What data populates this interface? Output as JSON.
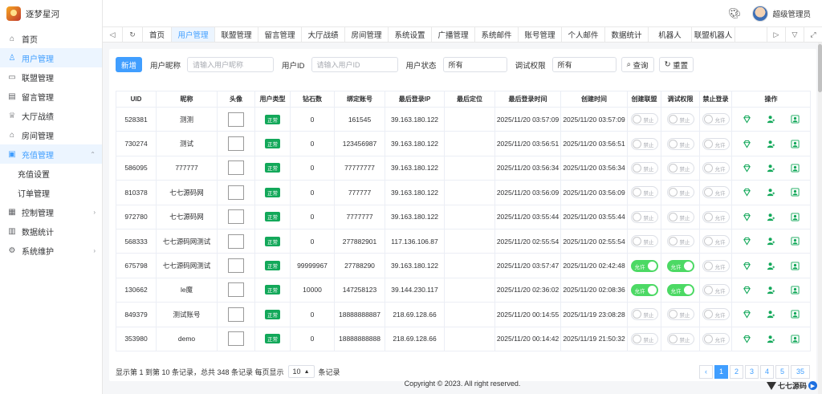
{
  "brand": {
    "name": "逐梦星河"
  },
  "sidebar": {
    "items": [
      {
        "label": "首页",
        "icon": "home-icon",
        "glyph": "⌂"
      },
      {
        "label": "用户管理",
        "icon": "user-icon",
        "glyph": "👤"
      },
      {
        "label": "联盟管理",
        "icon": "alliance-icon",
        "glyph": "▭"
      },
      {
        "label": "留言管理",
        "icon": "message-icon",
        "glyph": "✉"
      },
      {
        "label": "大厅战绩",
        "icon": "trophy-icon",
        "glyph": "♕"
      },
      {
        "label": "房间管理",
        "icon": "room-icon",
        "glyph": "⌂"
      },
      {
        "label": "充值管理",
        "icon": "recharge-icon",
        "glyph": "▣"
      },
      {
        "label": "充值设置"
      },
      {
        "label": "订单管理"
      },
      {
        "label": "控制管理",
        "icon": "control-icon",
        "glyph": "▦"
      },
      {
        "label": "数据统计",
        "icon": "stats-icon",
        "glyph": "▥"
      },
      {
        "label": "系统维护",
        "icon": "settings-icon",
        "glyph": "⚙"
      }
    ]
  },
  "topbar": {
    "username": "超级管理员"
  },
  "tabs": [
    "首页",
    "用户管理",
    "联盟管理",
    "留言管理",
    "大厅战绩",
    "房间管理",
    "系统设置",
    "广播管理",
    "系统邮件",
    "账号管理",
    "个人邮件",
    "数据统计",
    "机器人",
    "联盟机器人"
  ],
  "filter": {
    "add_label": "新增",
    "nickname_label": "用户昵称",
    "nickname_placeholder": "请输入用户昵称",
    "uid_label": "用户ID",
    "uid_placeholder": "请输入用户ID",
    "status_label": "用户状态",
    "status_value": "所有",
    "debug_label": "调试权限",
    "debug_value": "所有",
    "search_label": "查询",
    "reset_label": "重置"
  },
  "table": {
    "headers": [
      "UID",
      "昵称",
      "头像",
      "用户类型",
      "钻石数",
      "绑定账号",
      "最后登录IP",
      "最后定位",
      "最后登录时间",
      "创建时间",
      "创建联盟",
      "调试权限",
      "禁止登录",
      "操作"
    ],
    "rows": [
      {
        "uid": "528381",
        "nick": "测测",
        "type": "正常",
        "diamond": "0",
        "account": "161545",
        "ip": "39.163.180.122",
        "loc": "",
        "last": "2025/11/20 03:57:09",
        "created": "2025/11/20 03:57:09",
        "alliance": false,
        "debug": false,
        "ban": false
      },
      {
        "uid": "730274",
        "nick": "测试",
        "type": "正常",
        "diamond": "0",
        "account": "123456987",
        "ip": "39.163.180.122",
        "loc": "",
        "last": "2025/11/20 03:56:51",
        "created": "2025/11/20 03:56:51",
        "alliance": false,
        "debug": false,
        "ban": false
      },
      {
        "uid": "586095",
        "nick": "777777",
        "type": "正常",
        "diamond": "0",
        "account": "77777777",
        "ip": "39.163.180.122",
        "loc": "",
        "last": "2025/11/20 03:56:34",
        "created": "2025/11/20 03:56:34",
        "alliance": false,
        "debug": false,
        "ban": false
      },
      {
        "uid": "810378",
        "nick": "七七源码网",
        "type": "正常",
        "diamond": "0",
        "account": "777777",
        "ip": "39.163.180.122",
        "loc": "",
        "last": "2025/11/20 03:56:09",
        "created": "2025/11/20 03:56:09",
        "alliance": false,
        "debug": false,
        "ban": false
      },
      {
        "uid": "972780",
        "nick": "七七源码网",
        "type": "正常",
        "diamond": "0",
        "account": "7777777",
        "ip": "39.163.180.122",
        "loc": "",
        "last": "2025/11/20 03:55:44",
        "created": "2025/11/20 03:55:44",
        "alliance": false,
        "debug": false,
        "ban": false
      },
      {
        "uid": "568333",
        "nick": "七七源码网测试",
        "type": "正常",
        "diamond": "0",
        "account": "277882901",
        "ip": "117.136.106.87",
        "loc": "",
        "last": "2025/11/20 02:55:54",
        "created": "2025/11/20 02:55:54",
        "alliance": false,
        "debug": false,
        "ban": false
      },
      {
        "uid": "675798",
        "nick": "七七源码网测试",
        "type": "正常",
        "diamond": "99999967",
        "account": "27788290",
        "ip": "39.163.180.122",
        "loc": "",
        "last": "2025/11/20 03:57:47",
        "created": "2025/11/20 02:42:48",
        "alliance": true,
        "debug": true,
        "ban": false
      },
      {
        "uid": "130662",
        "nick": "le魔",
        "type": "正常",
        "diamond": "10000",
        "account": "147258123",
        "ip": "39.144.230.117",
        "loc": "",
        "last": "2025/11/20 02:36:02",
        "created": "2025/11/20 02:08:36",
        "alliance": true,
        "debug": true,
        "ban": false
      },
      {
        "uid": "849379",
        "nick": "测试账号",
        "type": "正常",
        "diamond": "0",
        "account": "18888888887",
        "ip": "218.69.128.66",
        "loc": "",
        "last": "2025/11/20 00:14:55",
        "created": "2025/11/19 23:08:28",
        "alliance": false,
        "debug": false,
        "ban": false
      },
      {
        "uid": "353980",
        "nick": "demo",
        "type": "正常",
        "diamond": "0",
        "account": "18888888888",
        "ip": "218.69.128.66",
        "loc": "",
        "last": "2025/11/20 00:14:42",
        "created": "2025/11/19 21:50:32",
        "alliance": false,
        "debug": false,
        "ban": false
      }
    ],
    "switch_on": "允许",
    "switch_off_forbid": "禁止",
    "switch_off_allow": "允许"
  },
  "pagination": {
    "summary": "显示第 1 到第 10 条记录，总共 348 条记录 每页显示",
    "per_page": "10",
    "suffix": "条记录",
    "pages": [
      "1",
      "2",
      "3",
      "4",
      "5"
    ],
    "last_page": "35",
    "prev": "‹"
  },
  "footer": {
    "copyright": "Copyright © 2023. All right reserved."
  },
  "watermark": {
    "text": "七七源码"
  },
  "colors": {
    "primary": "#409eff",
    "success": "#13a85a"
  }
}
